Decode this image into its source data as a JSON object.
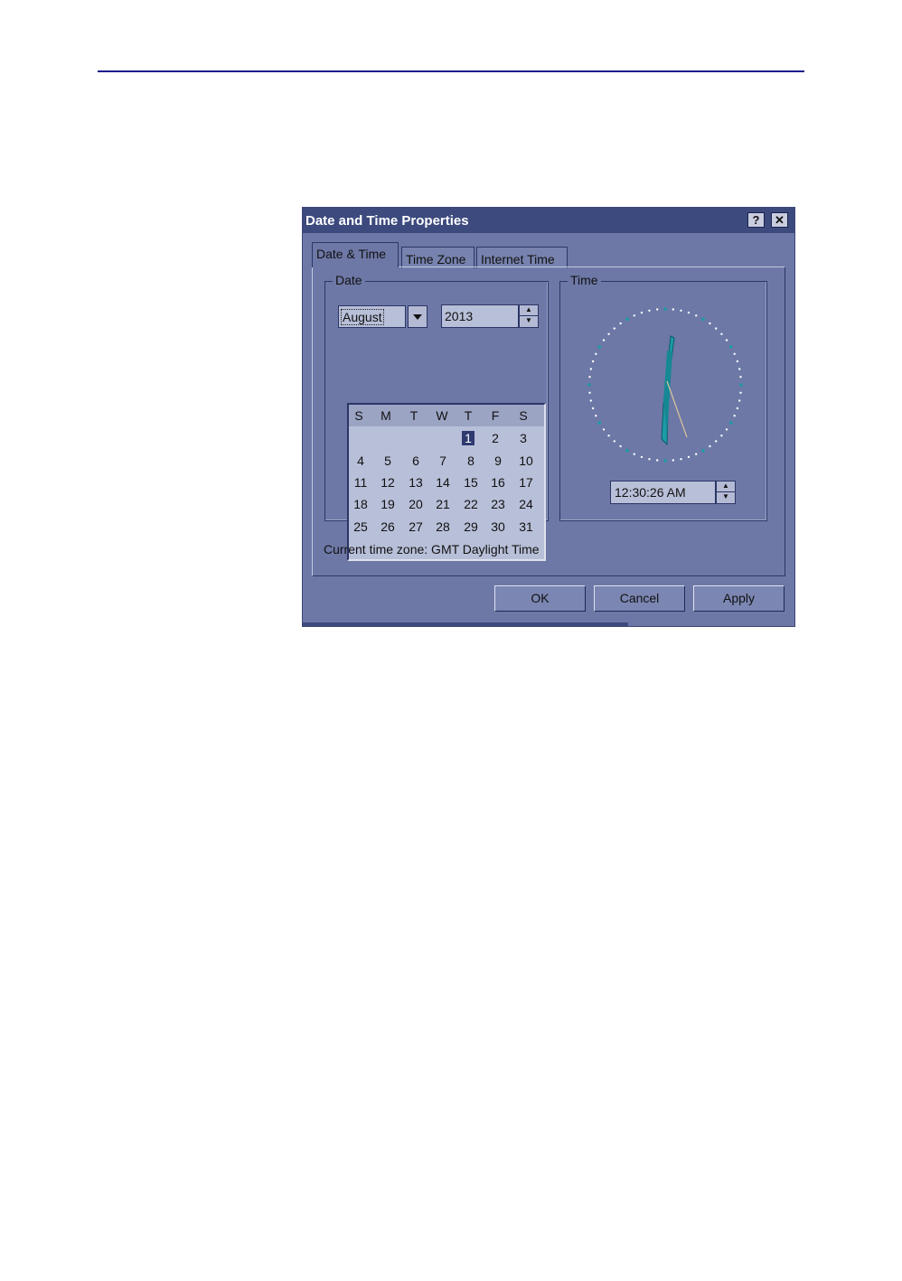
{
  "window": {
    "title": "Date and Time Properties",
    "help_glyph": "?",
    "close_glyph": "✕"
  },
  "tabs": [
    "Date & Time",
    "Time Zone",
    "Internet Time"
  ],
  "date_group": {
    "label": "Date",
    "month": "August",
    "year": "2013",
    "weekdays": [
      "S",
      "M",
      "T",
      "W",
      "T",
      "F",
      "S"
    ],
    "selected_day": "1",
    "weeks": [
      [
        "",
        "",
        "",
        "",
        "1",
        "2",
        "3"
      ],
      [
        "4",
        "5",
        "6",
        "7",
        "8",
        "9",
        "10"
      ],
      [
        "11",
        "12",
        "13",
        "14",
        "15",
        "16",
        "17"
      ],
      [
        "18",
        "19",
        "20",
        "21",
        "22",
        "23",
        "24"
      ],
      [
        "25",
        "26",
        "27",
        "28",
        "29",
        "30",
        "31"
      ]
    ]
  },
  "time_group": {
    "label": "Time",
    "time_value": "12:30:26 AM"
  },
  "status": {
    "time_zone_text": "Current time zone:  GMT Daylight Time"
  },
  "buttons": {
    "ok": "OK",
    "cancel": "Cancel",
    "apply": "Apply"
  },
  "colors": {
    "dialog_bg": "#6d78a6",
    "titlebar_bg": "#3d4a7e",
    "clock_hand": "#1c9aa6",
    "selected_day_bg": "#2f3a70"
  }
}
